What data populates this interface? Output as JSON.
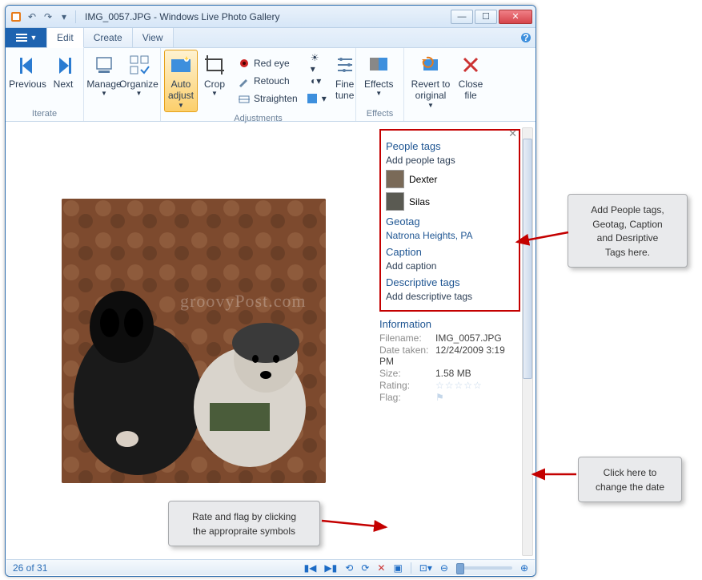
{
  "title": {
    "file": "IMG_0057.JPG",
    "app": "Windows Live Photo Gallery"
  },
  "tabs": {
    "edit": "Edit",
    "create": "Create",
    "view": "View"
  },
  "ribbon": {
    "iterate": {
      "label": "Iterate",
      "previous": "Previous",
      "next": "Next"
    },
    "manage": "Manage",
    "organize": "Organize",
    "adjustments": {
      "label": "Adjustments",
      "auto": "Auto\nadjust",
      "crop": "Crop",
      "redeye": "Red eye",
      "retouch": "Retouch",
      "straighten": "Straighten",
      "fine": "Fine\ntune"
    },
    "effects": {
      "label": "Effects",
      "effects": "Effects"
    },
    "revert": "Revert to\noriginal",
    "close": "Close\nfile"
  },
  "side": {
    "people": {
      "head": "People tags",
      "add": "Add people tags",
      "p1": "Dexter",
      "p2": "Silas"
    },
    "geotag": {
      "head": "Geotag",
      "val": "Natrona Heights, PA"
    },
    "caption": {
      "head": "Caption",
      "add": "Add caption"
    },
    "desc": {
      "head": "Descriptive tags",
      "add": "Add descriptive tags"
    },
    "info": {
      "head": "Information",
      "fn_l": "Filename:",
      "fn": "IMG_0057.JPG",
      "dt_l": "Date taken:",
      "dt": "12/24/2009  3:19 PM",
      "sz_l": "Size:",
      "sz": "1.58 MB",
      "rt_l": "Rating:",
      "fl_l": "Flag:"
    }
  },
  "status": {
    "count": "26 of 31"
  },
  "callouts": {
    "c1": "Add People tags,\nGeotag, Caption\nand Desriptive\nTags here.",
    "c2": "Click here to\nchange the date",
    "c3": "Rate and flag by clicking\nthe appropraite symbols"
  },
  "watermark": "groovyPost.com"
}
